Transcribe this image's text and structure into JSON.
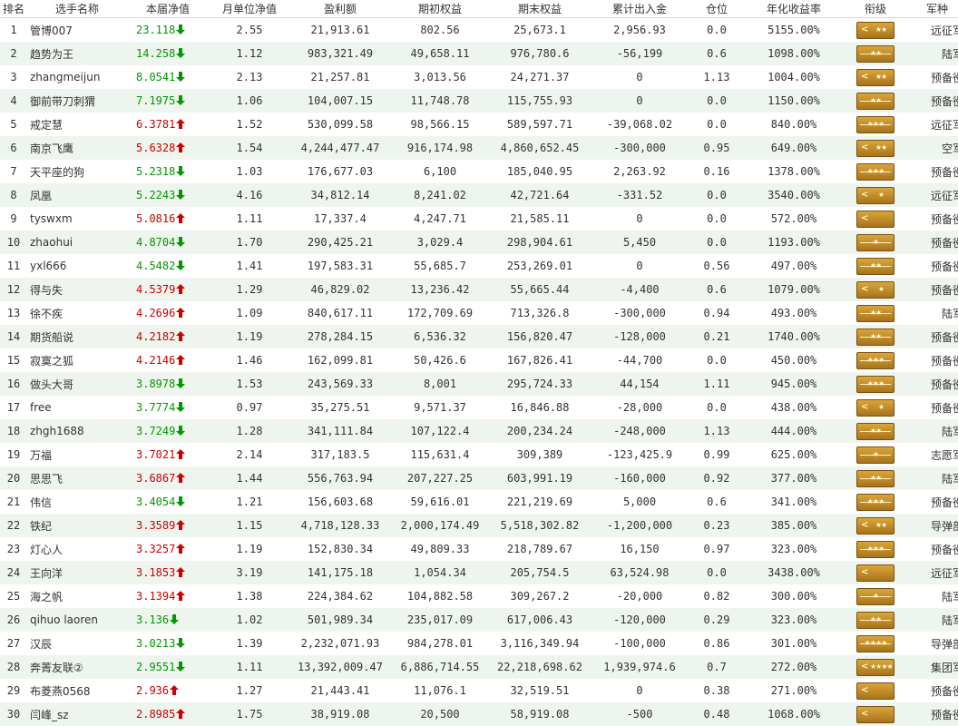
{
  "headers": {
    "rank": "排名",
    "name": "选手名称",
    "nav": "本届净值",
    "monthly_nav": "月单位净值",
    "profit": "盈利额",
    "start_equity": "期初权益",
    "end_equity": "期末权益",
    "net_flow": "累计出入金",
    "position": "仓位",
    "annual": "年化收益率",
    "insignia": "衔级",
    "branch": "军种"
  },
  "colors": {
    "up": "#cc0000",
    "down": "#009900",
    "row_alt": "#eef5ee"
  },
  "rows": [
    {
      "rank": "1",
      "name": "管博007",
      "nav": "23.118",
      "dir": "down",
      "monthly_nav": "2.55",
      "profit": "21,913.61",
      "start_equity": "802.56",
      "end_equity": "25,673.1",
      "net_flow": "2,956.93",
      "position": "0.0",
      "annual": "5155.00%",
      "insignia": "chevron-2star",
      "branch": "远征军"
    },
    {
      "rank": "2",
      "name": "趋势为王",
      "nav": "14.258",
      "dir": "down",
      "monthly_nav": "1.12",
      "profit": "983,321.49",
      "start_equity": "49,658.11",
      "end_equity": "976,780.6",
      "net_flow": "-56,199",
      "position": "0.6",
      "annual": "1098.00%",
      "insignia": "2star-bar",
      "branch": "陆军"
    },
    {
      "rank": "3",
      "name": "zhangmeijun",
      "nav": "8.0541",
      "dir": "down",
      "monthly_nav": "2.13",
      "profit": "21,257.81",
      "start_equity": "3,013.56",
      "end_equity": "24,271.37",
      "net_flow": "0",
      "position": "1.13",
      "annual": "1004.00%",
      "insignia": "chevron-2star",
      "branch": "预备役"
    },
    {
      "rank": "4",
      "name": "御前带刀刺猬",
      "nav": "7.1975",
      "dir": "down",
      "monthly_nav": "1.06",
      "profit": "104,007.15",
      "start_equity": "11,748.78",
      "end_equity": "115,755.93",
      "net_flow": "0",
      "position": "0.0",
      "annual": "1150.00%",
      "insignia": "2star-bar",
      "branch": "预备役"
    },
    {
      "rank": "5",
      "name": "戒定慧",
      "nav": "6.3781",
      "dir": "up",
      "monthly_nav": "1.52",
      "profit": "530,099.58",
      "start_equity": "98,566.15",
      "end_equity": "589,597.71",
      "net_flow": "-39,068.02",
      "position": "0.0",
      "annual": "840.00%",
      "insignia": "3star-bar",
      "branch": "远征军"
    },
    {
      "rank": "6",
      "name": "南京飞鹰",
      "nav": "5.6328",
      "dir": "up",
      "monthly_nav": "1.54",
      "profit": "4,244,477.47",
      "start_equity": "916,174.98",
      "end_equity": "4,860,652.45",
      "net_flow": "-300,000",
      "position": "0.95",
      "annual": "649.00%",
      "insignia": "chevron-2star",
      "branch": "空军"
    },
    {
      "rank": "7",
      "name": "天平座的狗",
      "nav": "5.2318",
      "dir": "down",
      "monthly_nav": "1.03",
      "profit": "176,677.03",
      "start_equity": "6,100",
      "end_equity": "185,040.95",
      "net_flow": "2,263.92",
      "position": "0.16",
      "annual": "1378.00%",
      "insignia": "3star-bar",
      "branch": "预备役"
    },
    {
      "rank": "8",
      "name": "凤凰",
      "nav": "5.2243",
      "dir": "down",
      "monthly_nav": "4.16",
      "profit": "34,812.14",
      "start_equity": "8,241.02",
      "end_equity": "42,721.64",
      "net_flow": "-331.52",
      "position": "0.0",
      "annual": "3540.00%",
      "insignia": "chevron-1star",
      "branch": "远征军"
    },
    {
      "rank": "9",
      "name": "tyswxm",
      "nav": "5.0816",
      "dir": "up",
      "monthly_nav": "1.11",
      "profit": "17,337.4",
      "start_equity": "4,247.71",
      "end_equity": "21,585.11",
      "net_flow": "0",
      "position": "0.0",
      "annual": "572.00%",
      "insignia": "chevron",
      "branch": "预备役"
    },
    {
      "rank": "10",
      "name": "zhaohui",
      "nav": "4.8704",
      "dir": "down",
      "monthly_nav": "1.70",
      "profit": "290,425.21",
      "start_equity": "3,029.4",
      "end_equity": "298,904.61",
      "net_flow": "5,450",
      "position": "0.0",
      "annual": "1193.00%",
      "insignia": "1star-bar",
      "branch": "预备役"
    },
    {
      "rank": "11",
      "name": "yxl666",
      "nav": "4.5482",
      "dir": "down",
      "monthly_nav": "1.41",
      "profit": "197,583.31",
      "start_equity": "55,685.7",
      "end_equity": "253,269.01",
      "net_flow": "0",
      "position": "0.56",
      "annual": "497.00%",
      "insignia": "2star-bar",
      "branch": "预备役"
    },
    {
      "rank": "12",
      "name": "得与失",
      "nav": "4.5379",
      "dir": "up",
      "monthly_nav": "1.29",
      "profit": "46,829.02",
      "start_equity": "13,236.42",
      "end_equity": "55,665.44",
      "net_flow": "-4,400",
      "position": "0.6",
      "annual": "1079.00%",
      "insignia": "chevron-1star",
      "branch": "预备役"
    },
    {
      "rank": "13",
      "name": "徐不疾",
      "nav": "4.2696",
      "dir": "up",
      "monthly_nav": "1.09",
      "profit": "840,617.11",
      "start_equity": "172,709.69",
      "end_equity": "713,326.8",
      "net_flow": "-300,000",
      "position": "0.94",
      "annual": "493.00%",
      "insignia": "2star-bar",
      "branch": "陆军"
    },
    {
      "rank": "14",
      "name": "期货船说",
      "nav": "4.2182",
      "dir": "up",
      "monthly_nav": "1.19",
      "profit": "278,284.15",
      "start_equity": "6,536.32",
      "end_equity": "156,820.47",
      "net_flow": "-128,000",
      "position": "0.21",
      "annual": "1740.00%",
      "insignia": "2star-bar",
      "branch": "预备役"
    },
    {
      "rank": "15",
      "name": "寂寞之狐",
      "nav": "4.2146",
      "dir": "up",
      "monthly_nav": "1.46",
      "profit": "162,099.81",
      "start_equity": "50,426.6",
      "end_equity": "167,826.41",
      "net_flow": "-44,700",
      "position": "0.0",
      "annual": "450.00%",
      "insignia": "3star-bar",
      "branch": "预备役"
    },
    {
      "rank": "16",
      "name": "做头大哥",
      "nav": "3.8978",
      "dir": "down",
      "monthly_nav": "1.53",
      "profit": "243,569.33",
      "start_equity": "8,001",
      "end_equity": "295,724.33",
      "net_flow": "44,154",
      "position": "1.11",
      "annual": "945.00%",
      "insignia": "3star-bar",
      "branch": "预备役"
    },
    {
      "rank": "17",
      "name": "free",
      "nav": "3.7774",
      "dir": "down",
      "monthly_nav": "0.97",
      "profit": "35,275.51",
      "start_equity": "9,571.37",
      "end_equity": "16,846.88",
      "net_flow": "-28,000",
      "position": "0.0",
      "annual": "438.00%",
      "insignia": "chevron-1star",
      "branch": "预备役"
    },
    {
      "rank": "18",
      "name": "zhgh1688",
      "nav": "3.7249",
      "dir": "down",
      "monthly_nav": "1.28",
      "profit": "341,111.84",
      "start_equity": "107,122.4",
      "end_equity": "200,234.24",
      "net_flow": "-248,000",
      "position": "1.13",
      "annual": "444.00%",
      "insignia": "2star-bar",
      "branch": "陆军"
    },
    {
      "rank": "19",
      "name": "万福",
      "nav": "3.7021",
      "dir": "up",
      "monthly_nav": "2.14",
      "profit": "317,183.5",
      "start_equity": "115,631.4",
      "end_equity": "309,389",
      "net_flow": "-123,425.9",
      "position": "0.99",
      "annual": "625.00%",
      "insignia": "1star-bar",
      "branch": "志愿军"
    },
    {
      "rank": "20",
      "name": "思思飞",
      "nav": "3.6867",
      "dir": "up",
      "monthly_nav": "1.44",
      "profit": "556,763.94",
      "start_equity": "207,227.25",
      "end_equity": "603,991.19",
      "net_flow": "-160,000",
      "position": "0.92",
      "annual": "377.00%",
      "insignia": "2star-bar",
      "branch": "陆军"
    },
    {
      "rank": "21",
      "name": "伟信",
      "nav": "3.4054",
      "dir": "down",
      "monthly_nav": "1.21",
      "profit": "156,603.68",
      "start_equity": "59,616.01",
      "end_equity": "221,219.69",
      "net_flow": "5,000",
      "position": "0.6",
      "annual": "341.00%",
      "insignia": "3star-bar",
      "branch": "预备役"
    },
    {
      "rank": "22",
      "name": "铁纪",
      "nav": "3.3589",
      "dir": "up",
      "monthly_nav": "1.15",
      "profit": "4,718,128.33",
      "start_equity": "2,000,174.49",
      "end_equity": "5,518,302.82",
      "net_flow": "-1,200,000",
      "position": "0.23",
      "annual": "385.00%",
      "insignia": "chevron-2star",
      "branch": "导弹部"
    },
    {
      "rank": "23",
      "name": "灯心人",
      "nav": "3.3257",
      "dir": "up",
      "monthly_nav": "1.19",
      "profit": "152,830.34",
      "start_equity": "49,809.33",
      "end_equity": "218,789.67",
      "net_flow": "16,150",
      "position": "0.97",
      "annual": "323.00%",
      "insignia": "3star-bar",
      "branch": "预备役"
    },
    {
      "rank": "24",
      "name": "王向洋",
      "nav": "3.1853",
      "dir": "up",
      "monthly_nav": "3.19",
      "profit": "141,175.18",
      "start_equity": "1,054.34",
      "end_equity": "205,754.5",
      "net_flow": "63,524.98",
      "position": "0.0",
      "annual": "3438.00%",
      "insignia": "chevron",
      "branch": "远征军"
    },
    {
      "rank": "25",
      "name": "海之帆",
      "nav": "3.1394",
      "dir": "up",
      "monthly_nav": "1.38",
      "profit": "224,384.62",
      "start_equity": "104,882.58",
      "end_equity": "309,267.2",
      "net_flow": "-20,000",
      "position": "0.82",
      "annual": "300.00%",
      "insignia": "1star-bar",
      "branch": "陆军"
    },
    {
      "rank": "26",
      "name": "qihuo laoren",
      "nav": "3.136",
      "dir": "down",
      "monthly_nav": "1.02",
      "profit": "501,989.34",
      "start_equity": "235,017.09",
      "end_equity": "617,006.43",
      "net_flow": "-120,000",
      "position": "0.29",
      "annual": "323.00%",
      "insignia": "2star-bar",
      "branch": "陆军"
    },
    {
      "rank": "27",
      "name": "汉辰",
      "nav": "3.0213",
      "dir": "down",
      "monthly_nav": "1.39",
      "profit": "2,232,071.93",
      "start_equity": "984,278.01",
      "end_equity": "3,116,349.94",
      "net_flow": "-100,000",
      "position": "0.86",
      "annual": "301.00%",
      "insignia": "4star-bar",
      "branch": "导弹部"
    },
    {
      "rank": "28",
      "name": "奔菁友联②",
      "nav": "2.9551",
      "dir": "down",
      "monthly_nav": "1.11",
      "profit": "13,392,009.47",
      "start_equity": "6,886,714.55",
      "end_equity": "22,218,698.62",
      "net_flow": "1,939,974.6",
      "position": "0.7",
      "annual": "272.00%",
      "insignia": "chevron-4star",
      "branch": "集团军"
    },
    {
      "rank": "29",
      "name": "布菱燕0568",
      "nav": "2.936",
      "dir": "up",
      "monthly_nav": "1.27",
      "profit": "21,443.41",
      "start_equity": "11,076.1",
      "end_equity": "32,519.51",
      "net_flow": "0",
      "position": "0.38",
      "annual": "271.00%",
      "insignia": "chevron",
      "branch": "预备役"
    },
    {
      "rank": "30",
      "name": "闫峰_sz",
      "nav": "2.8985",
      "dir": "up",
      "monthly_nav": "1.75",
      "profit": "38,919.08",
      "start_equity": "20,500",
      "end_equity": "58,919.08",
      "net_flow": "-500",
      "position": "0.48",
      "annual": "1068.00%",
      "insignia": "chevron",
      "branch": "预备役"
    }
  ]
}
